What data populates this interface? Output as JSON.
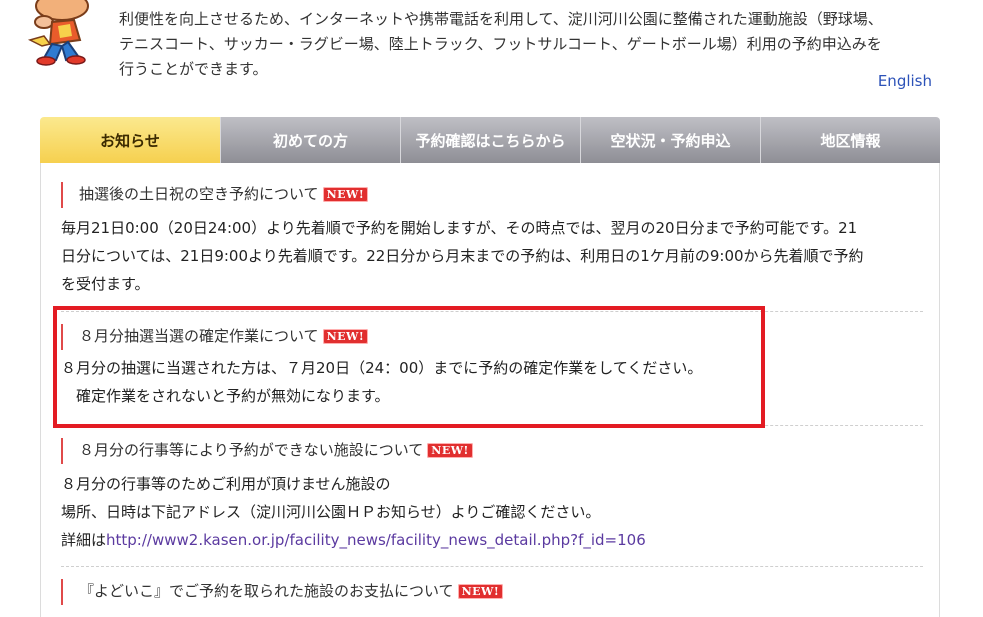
{
  "intro": {
    "line1": "利便性を向上させるため、インターネットや携帯電話を利用して、淀川河川公園に整備された運動施設（野球場、",
    "line2": "テニスコート、サッカー・ラグビー場、陸上トラック、フットサルコート、ゲートボール場）利用の予約申込みを",
    "line3": "行うことができます。"
  },
  "language_link": "English",
  "tabs": [
    {
      "label": "お知らせ",
      "active": true
    },
    {
      "label": "初めての方",
      "active": false
    },
    {
      "label": "予約確認はこちらから",
      "active": false
    },
    {
      "label": "空状況・予約申込",
      "active": false
    },
    {
      "label": "地区情報",
      "active": false
    }
  ],
  "badge_label": "NEW!",
  "news": [
    {
      "title": "抽選後の土日祝の空き予約について",
      "body": [
        "毎月21日0:00（20日24:00）より先着順で予約を開始しますが、その時点では、翌月の20日分まで予約可能です。21",
        "日分については、21日9:00より先着順です。22日分から月末までの予約は、利用日の1ケ月前の9:00から先着順で予約",
        "を受付ます。"
      ]
    },
    {
      "title": "８月分抽選当選の確定作業について",
      "body": [
        "８月分の抽選に当選された方は、７月20日（24：00）までに予約の確定作業をしてください。",
        "　確定作業をされないと予約が無効になります。"
      ]
    },
    {
      "title": "８月分の行事等により予約ができない施設について",
      "body": [
        "８月分の行事等のためご利用が頂けません施設の",
        "場所、日時は下記アドレス（淀川河川公園ＨＰお知らせ）よりご確認ください。"
      ],
      "link_prefix": "詳細は",
      "link_text": "http://www2.kasen.or.jp/facility_news/facility_news_detail.php?f_id=106"
    },
    {
      "title": "『よどいこ』でご予約を取られた施設のお支払について",
      "body": []
    }
  ],
  "colors": {
    "active_tab": "#f6d04f",
    "inactive_tab": "#9a9aa0",
    "new_badge": "#e12f2f",
    "highlight_border": "#e31b23",
    "link": "#5b3aa0"
  }
}
